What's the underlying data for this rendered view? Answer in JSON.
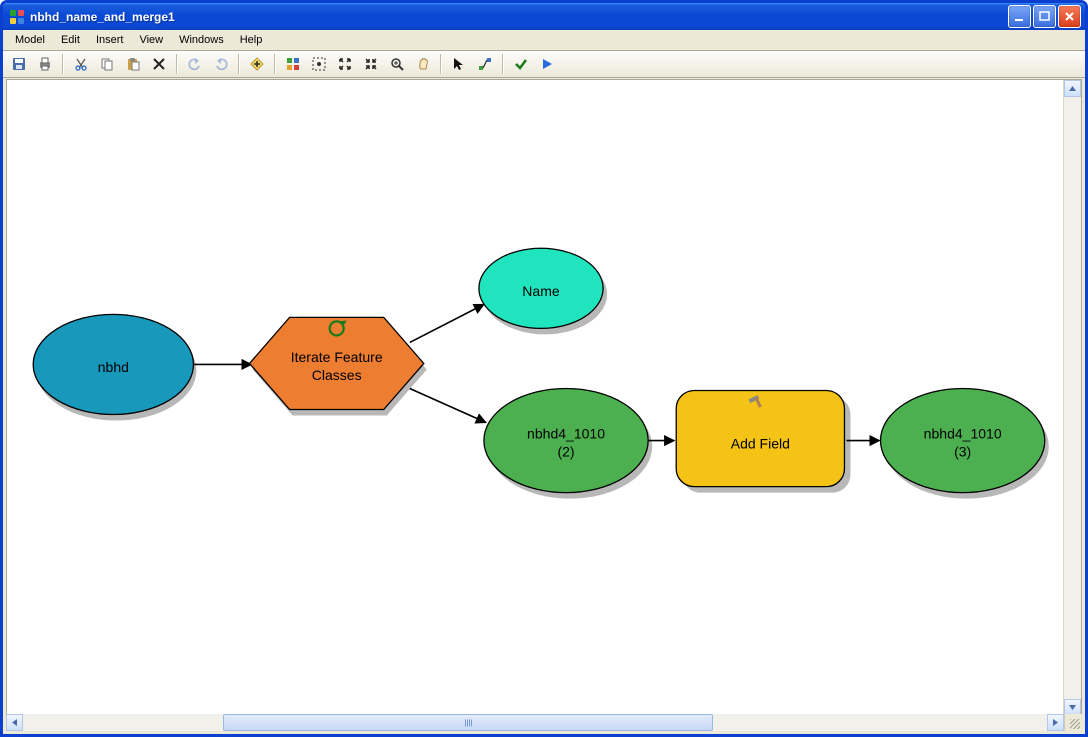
{
  "window": {
    "title": "nbhd_name_and_merge1"
  },
  "menu": {
    "items": [
      "Model",
      "Edit",
      "Insert",
      "View",
      "Windows",
      "Help"
    ]
  },
  "toolbar": {
    "buttons": [
      "save-icon",
      "print-icon",
      "sep",
      "cut-icon",
      "copy-icon",
      "paste-icon",
      "delete-icon",
      "sep",
      "undo-icon",
      "redo-icon",
      "sep",
      "add-data-icon",
      "sep",
      "auto-layout-icon",
      "full-extent-icon",
      "zoom-in-fixed-icon",
      "zoom-out-fixed-icon",
      "zoom-tool-icon",
      "pan-icon",
      "sep",
      "select-icon",
      "connect-icon",
      "sep",
      "validate-icon",
      "run-icon"
    ]
  },
  "diagram": {
    "nodes": {
      "input": {
        "label": "nbhd"
      },
      "iterator": {
        "line1": "Iterate Feature",
        "line2": "Classes"
      },
      "out_name": {
        "label": "Name"
      },
      "out_fc": {
        "line1": "nbhd4_1010",
        "line2": "(2)"
      },
      "tool": {
        "label": "Add Field"
      },
      "tool_out": {
        "line1": "nbhd4_1010",
        "line2": "(3)"
      }
    }
  },
  "colors": {
    "input": "#1898bb",
    "iterator": "#ed7d31",
    "derived": "#4cb050",
    "name": "#1fe4bd",
    "tool": "#f5c316"
  }
}
